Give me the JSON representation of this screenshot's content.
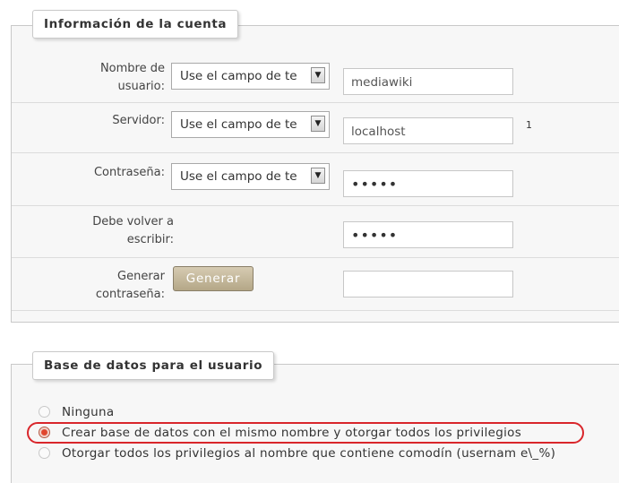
{
  "account": {
    "legend": "Información de la cuenta",
    "username": {
      "label_line1": "Nombre de",
      "label_line2": "usuario:",
      "select_value": "Use el campo de te",
      "value": "mediawiki"
    },
    "server": {
      "label": "Servidor:",
      "select_value": "Use el campo de te",
      "value": "localhost",
      "note": "1"
    },
    "password": {
      "label": "Contraseña:",
      "select_value": "Use el campo de te",
      "value": "•••••"
    },
    "retype": {
      "label_line1": "Debe volver a",
      "label_line2": "escribir:",
      "value": "•••••"
    },
    "generate": {
      "label_line1": "Generar",
      "label_line2": "contraseña:",
      "button_label": "Generar",
      "value": ""
    }
  },
  "database": {
    "legend": "Base de datos para el usuario",
    "options": [
      {
        "label": "Ninguna",
        "selected": false
      },
      {
        "label": "Crear base de datos con el mismo nombre y otorgar todos los privilegios",
        "selected": true
      },
      {
        "label": "Otorgar todos los privilegios al nombre que contiene comodín (usernam e\\_%)",
        "selected": false
      }
    ]
  },
  "colors": {
    "highlight": "#d9262b",
    "button": "#b4a787",
    "radio_selected": "#e0452d"
  }
}
